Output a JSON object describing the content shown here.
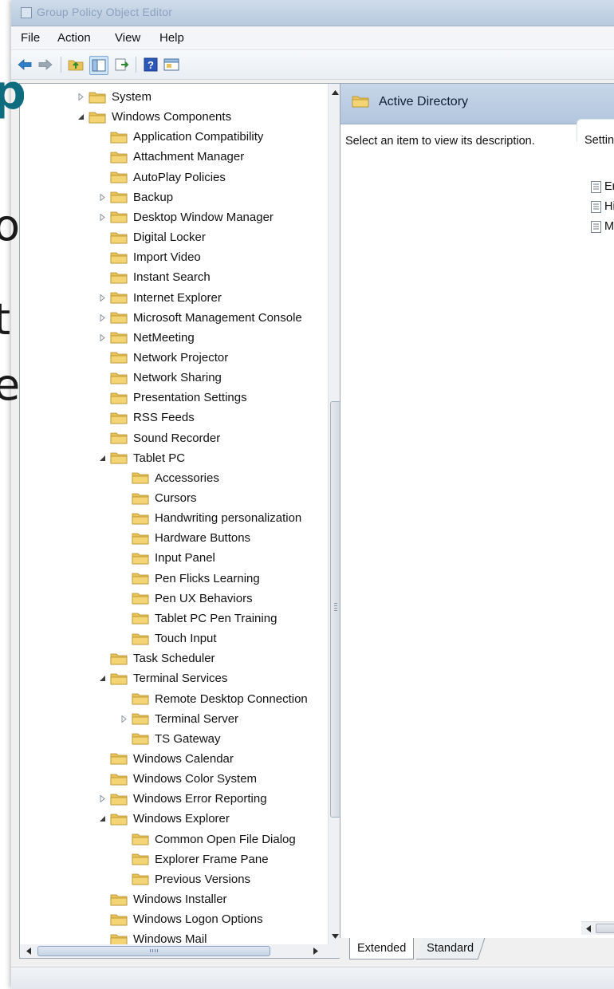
{
  "window": {
    "title": "Group Policy Object Editor"
  },
  "background": {
    "letters": [
      "p",
      "o",
      "t",
      "e"
    ]
  },
  "menu": {
    "items": [
      "File",
      "Action",
      "View",
      "Help"
    ]
  },
  "toolbar": {
    "buttons": [
      "back-icon",
      "forward-icon",
      "up-folder-icon",
      "show-hide-tree-icon",
      "export-list-icon",
      "help-icon",
      "properties-icon"
    ]
  },
  "tree": {
    "items": [
      {
        "label": "System",
        "level": 0,
        "expander": "collapsed"
      },
      {
        "label": "Windows Components",
        "level": 0,
        "expander": "expanded"
      },
      {
        "label": "Application Compatibility",
        "level": 1,
        "expander": "none"
      },
      {
        "label": "Attachment Manager",
        "level": 1,
        "expander": "none"
      },
      {
        "label": "AutoPlay Policies",
        "level": 1,
        "expander": "none"
      },
      {
        "label": "Backup",
        "level": 1,
        "expander": "collapsed"
      },
      {
        "label": "Desktop Window Manager",
        "level": 1,
        "expander": "collapsed"
      },
      {
        "label": "Digital Locker",
        "level": 1,
        "expander": "none"
      },
      {
        "label": "Import Video",
        "level": 1,
        "expander": "none"
      },
      {
        "label": "Instant Search",
        "level": 1,
        "expander": "none"
      },
      {
        "label": "Internet Explorer",
        "level": 1,
        "expander": "collapsed"
      },
      {
        "label": "Microsoft Management Console",
        "level": 1,
        "expander": "collapsed"
      },
      {
        "label": "NetMeeting",
        "level": 1,
        "expander": "collapsed"
      },
      {
        "label": "Network Projector",
        "level": 1,
        "expander": "none"
      },
      {
        "label": "Network Sharing",
        "level": 1,
        "expander": "none"
      },
      {
        "label": "Presentation Settings",
        "level": 1,
        "expander": "none"
      },
      {
        "label": "RSS Feeds",
        "level": 1,
        "expander": "none"
      },
      {
        "label": "Sound Recorder",
        "level": 1,
        "expander": "none"
      },
      {
        "label": "Tablet PC",
        "level": 1,
        "expander": "expanded"
      },
      {
        "label": "Accessories",
        "level": 2,
        "expander": "none"
      },
      {
        "label": "Cursors",
        "level": 2,
        "expander": "none"
      },
      {
        "label": "Handwriting personalization",
        "level": 2,
        "expander": "none"
      },
      {
        "label": "Hardware Buttons",
        "level": 2,
        "expander": "none"
      },
      {
        "label": "Input Panel",
        "level": 2,
        "expander": "none"
      },
      {
        "label": "Pen Flicks Learning",
        "level": 2,
        "expander": "none"
      },
      {
        "label": "Pen UX Behaviors",
        "level": 2,
        "expander": "none"
      },
      {
        "label": "Tablet PC Pen Training",
        "level": 2,
        "expander": "none"
      },
      {
        "label": "Touch Input",
        "level": 2,
        "expander": "none"
      },
      {
        "label": "Task Scheduler",
        "level": 1,
        "expander": "none"
      },
      {
        "label": "Terminal Services",
        "level": 1,
        "expander": "expanded"
      },
      {
        "label": "Remote Desktop Connection",
        "level": 2,
        "expander": "none"
      },
      {
        "label": "Terminal Server",
        "level": 2,
        "expander": "collapsed"
      },
      {
        "label": "TS Gateway",
        "level": 2,
        "expander": "none"
      },
      {
        "label": "Windows Calendar",
        "level": 1,
        "expander": "none"
      },
      {
        "label": "Windows Color System",
        "level": 1,
        "expander": "none"
      },
      {
        "label": "Windows Error Reporting",
        "level": 1,
        "expander": "collapsed"
      },
      {
        "label": "Windows Explorer",
        "level": 1,
        "expander": "expanded"
      },
      {
        "label": "Common Open File Dialog",
        "level": 2,
        "expander": "none"
      },
      {
        "label": "Explorer Frame Pane",
        "level": 2,
        "expander": "none"
      },
      {
        "label": "Previous Versions",
        "level": 2,
        "expander": "none"
      },
      {
        "label": "Windows Installer",
        "level": 1,
        "expander": "none"
      },
      {
        "label": "Windows Logon Options",
        "level": 1,
        "expander": "none"
      },
      {
        "label": "Windows Mail",
        "level": 1,
        "expander": "none"
      }
    ]
  },
  "details": {
    "header_title": "Active Directory",
    "description": "Select an item to view its description.",
    "column_header": "Settin",
    "settings": [
      "En",
      "Hi",
      "M"
    ]
  },
  "tabs": {
    "extended": "Extended",
    "standard": "Standard"
  },
  "colors": {
    "folder": "#e8c35a",
    "header_bg": "#c0d1e6",
    "slide_accent": "#0f6c7f"
  }
}
